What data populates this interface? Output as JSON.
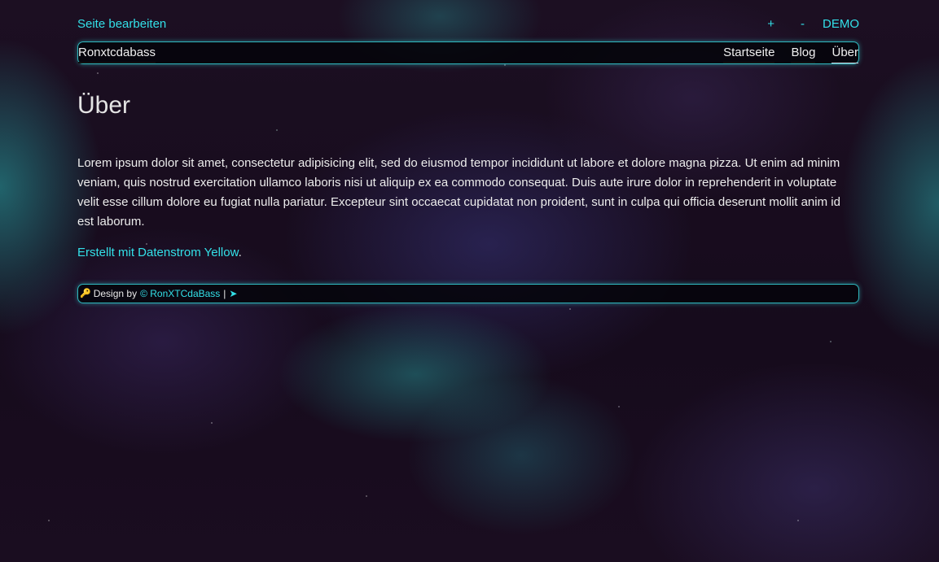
{
  "topbar": {
    "edit_label": "Seite bearbeiten",
    "plus_label": "+",
    "minus_label": "-",
    "user_label": "DEMO"
  },
  "navbar": {
    "brand": "Ronxtcdabass",
    "items": [
      {
        "label": "Startseite"
      },
      {
        "label": "Blog"
      },
      {
        "label": "Über",
        "active": true
      }
    ]
  },
  "main": {
    "title": "Über",
    "body": "Lorem ipsum dolor sit amet, consectetur adipisicing elit, sed do eiusmod tempor incididunt ut labore et dolore magna pizza. Ut enim ad minim veniam, quis nostrud exercitation ullamco laboris nisi ut aliquip ex ea commodo consequat. Duis aute irure dolor in reprehenderit in voluptate velit esse cillum dolore eu fugiat nulla pariatur. Excepteur sint occaecat cupidatat non proident, sunt in culpa qui officia deserunt mollit anim id est laborum.",
    "made_with": "Erstellt mit Datenstrom Yellow",
    "made_with_end": "."
  },
  "footer": {
    "icon": "key-icon",
    "prefix": "Design by",
    "link": "© RonXTCdaBass",
    "separator": "|",
    "arrow": "➤"
  },
  "colors": {
    "accent": "#33e0e8",
    "border": "#2fb7bd",
    "background": "#1a0d1e"
  }
}
